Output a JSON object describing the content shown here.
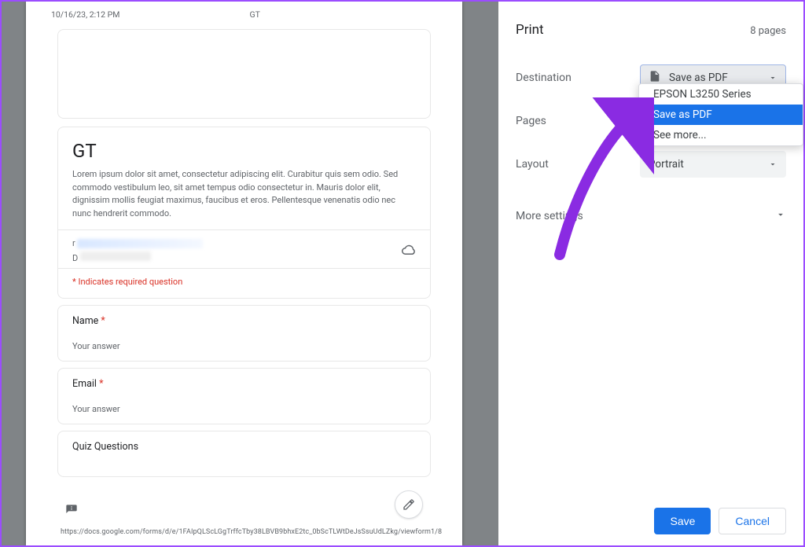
{
  "preview": {
    "timestamp": "10/16/23, 2:12 PM",
    "header_title": "GT",
    "form_title": "GT",
    "form_description": "Lorem ipsum dolor sit amet, consectetur adipiscing elit. Curabitur quis sem odio. Sed commodo vestibulum leo, sit amet tempus odio consectetur in. Mauris dolor elit, dignissim mollis feugiat maximus, faucibus et eros. Pellentesque venenatis odio nec nunc hendrerit commodo.",
    "required_note": "* Indicates required question",
    "questions": [
      {
        "label": "Name",
        "required": true,
        "placeholder": "Your answer"
      },
      {
        "label": "Email",
        "required": true,
        "placeholder": "Your answer"
      },
      {
        "label": "Quiz Questions",
        "required": false,
        "placeholder": ""
      }
    ],
    "footer_url": "https://docs.google.com/forms/d/e/1FAIpQLScLGgTrffcTby38LBVB9bhxE2tc_0bScTLWtDeJsSsuUdLZkg/viewform",
    "page_indicator": "1/8"
  },
  "print": {
    "title": "Print",
    "page_count_label": "8 pages",
    "destination_label": "Destination",
    "destination_value": "Save as PDF",
    "destination_options": [
      "EPSON L3250 Series",
      "Save as PDF",
      "See more..."
    ],
    "pages_label": "Pages",
    "layout_label": "Layout",
    "layout_value": "Portrait",
    "more_settings_label": "More settings",
    "save_button": "Save",
    "cancel_button": "Cancel"
  }
}
